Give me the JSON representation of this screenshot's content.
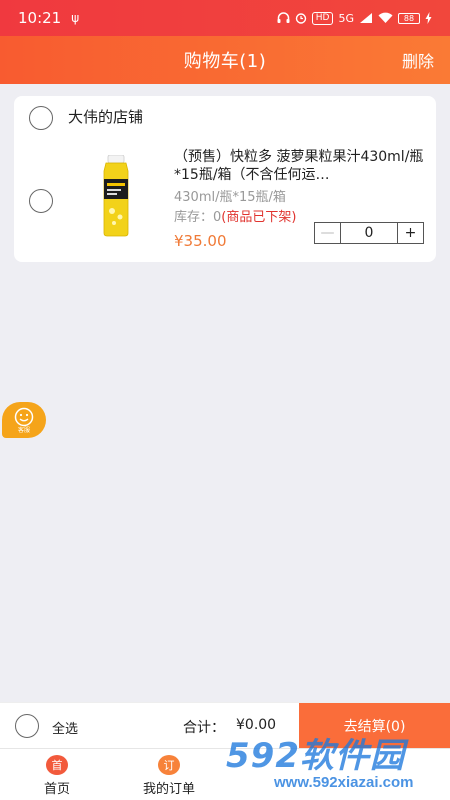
{
  "status_bar": {
    "time": "10:21",
    "usb_symbol": "ψ",
    "hd_label": "HD",
    "network_label": "5G",
    "battery": "88"
  },
  "header": {
    "title": "购物车(1)",
    "delete_label": "删除"
  },
  "cart": {
    "shop_name": "大伟的店铺",
    "item": {
      "title": "（预售）快粒多 菠萝果粒果汁430ml/瓶*15瓶/箱（不含任何运…",
      "spec": "430ml/瓶*15瓶/箱",
      "stock_label": "库存：0",
      "stock_status": "(商品已下架)",
      "price": "¥35.00",
      "quantity": "0",
      "minus_symbol": "—",
      "plus_symbol": "+"
    }
  },
  "service": {
    "label": "客服"
  },
  "bottom": {
    "select_all": "全选",
    "total_label": "合计：",
    "total_value": "¥0.00",
    "checkout": "去结算(0)"
  },
  "tabs": [
    {
      "label": "首页",
      "icon": "home-icon",
      "color": "#f25a3c",
      "glyph": "首"
    },
    {
      "label": "我的订单",
      "icon": "orders-icon",
      "color": "#f7823a",
      "glyph": "订"
    }
  ],
  "watermark": {
    "text": "592软件园",
    "url": "www.592xiazai.com"
  },
  "colors": {
    "primary": "#f85b30",
    "price": "#f07a37",
    "off_shelf": "#e0342f",
    "service_badge": "#f5a41a"
  }
}
